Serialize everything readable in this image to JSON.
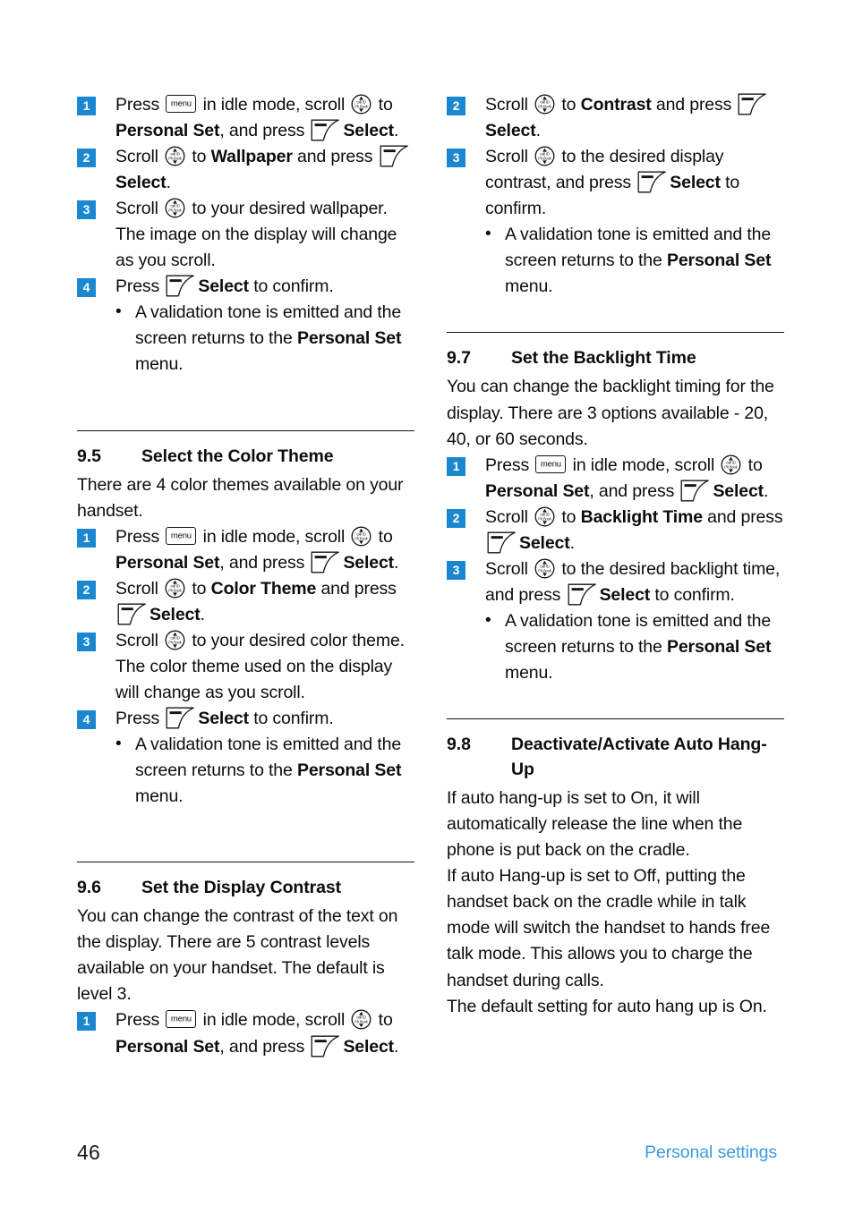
{
  "document": {
    "footer": {
      "page_number": "46",
      "section_title": "Personal settings"
    },
    "accent_color": "#1a87d0",
    "footer_link_color": "#3c9ae0"
  },
  "icons": {
    "menu_key_label": "menu",
    "scroll_key_top_label": "call ID",
    "scroll_key_bottom_label": "Ph.Book",
    "soft_key_name": "select-soft-key"
  },
  "left_column": {
    "wallpaper_steps": [
      {
        "number": "1",
        "parts": [
          {
            "t": "text",
            "v": "Press "
          },
          {
            "t": "icon",
            "v": "menu"
          },
          {
            "t": "text",
            "v": " in idle mode, scroll "
          },
          {
            "t": "icon",
            "v": "scroll"
          },
          {
            "t": "text",
            "v": " to "
          },
          {
            "t": "bold",
            "v": "Personal Set"
          },
          {
            "t": "text",
            "v": ", and press "
          },
          {
            "t": "icon",
            "v": "soft"
          },
          {
            "t": "bold",
            "v": "Select"
          },
          {
            "t": "text",
            "v": "."
          }
        ]
      },
      {
        "number": "2",
        "parts": [
          {
            "t": "text",
            "v": "Scroll "
          },
          {
            "t": "icon",
            "v": "scroll"
          },
          {
            "t": "text",
            "v": " to "
          },
          {
            "t": "bold",
            "v": "Wallpaper"
          },
          {
            "t": "text",
            "v": " and press "
          },
          {
            "t": "icon",
            "v": "soft"
          },
          {
            "t": "bold",
            "v": "Select"
          },
          {
            "t": "text",
            "v": "."
          }
        ]
      },
      {
        "number": "3",
        "parts": [
          {
            "t": "text",
            "v": "Scroll "
          },
          {
            "t": "icon",
            "v": "scroll"
          },
          {
            "t": "text",
            "v": " to your desired wallpaper. The image on the display will change as you scroll."
          }
        ]
      },
      {
        "number": "4",
        "parts": [
          {
            "t": "text",
            "v": "Press "
          },
          {
            "t": "icon",
            "v": "soft"
          },
          {
            "t": "bold",
            "v": "Select"
          },
          {
            "t": "text",
            "v": " to confirm."
          }
        ],
        "sub_bullets": [
          {
            "bullet": "•",
            "parts": [
              {
                "t": "text",
                "v": "A validation tone is emitted and the screen returns to the "
              },
              {
                "t": "bold",
                "v": "Personal Set"
              },
              {
                "t": "text",
                "v": " menu."
              }
            ]
          }
        ]
      }
    ],
    "section_9_5": {
      "number": "9.5",
      "title": "Select the Color Theme",
      "intro": "There are 4 color themes available on your handset.",
      "steps": [
        {
          "number": "1",
          "parts": [
            {
              "t": "text",
              "v": "Press "
            },
            {
              "t": "icon",
              "v": "menu"
            },
            {
              "t": "text",
              "v": " in idle mode, scroll "
            },
            {
              "t": "icon",
              "v": "scroll"
            },
            {
              "t": "text",
              "v": " to "
            },
            {
              "t": "bold",
              "v": "Personal Set"
            },
            {
              "t": "text",
              "v": ", and press "
            },
            {
              "t": "icon",
              "v": "soft"
            },
            {
              "t": "bold",
              "v": "Select"
            },
            {
              "t": "text",
              "v": "."
            }
          ]
        },
        {
          "number": "2",
          "parts": [
            {
              "t": "text",
              "v": "Scroll "
            },
            {
              "t": "icon",
              "v": "scroll"
            },
            {
              "t": "text",
              "v": " to "
            },
            {
              "t": "bold",
              "v": "Color Theme"
            },
            {
              "t": "text",
              "v": " and press "
            },
            {
              "t": "icon",
              "v": "soft"
            },
            {
              "t": "bold",
              "v": "Select"
            },
            {
              "t": "text",
              "v": "."
            }
          ]
        },
        {
          "number": "3",
          "parts": [
            {
              "t": "text",
              "v": "Scroll "
            },
            {
              "t": "icon",
              "v": "scroll"
            },
            {
              "t": "text",
              "v": " to your desired color theme. The color theme used on the display will change as you scroll."
            }
          ]
        },
        {
          "number": "4",
          "parts": [
            {
              "t": "text",
              "v": "Press "
            },
            {
              "t": "icon",
              "v": "soft"
            },
            {
              "t": "bold",
              "v": "Select"
            },
            {
              "t": "text",
              "v": " to confirm."
            }
          ],
          "sub_bullets": [
            {
              "bullet": "•",
              "parts": [
                {
                  "t": "text",
                  "v": "A validation tone is emitted and the screen returns to the "
                },
                {
                  "t": "bold",
                  "v": "Personal Set"
                },
                {
                  "t": "text",
                  "v": " menu."
                }
              ]
            }
          ]
        }
      ]
    },
    "section_9_6": {
      "number": "9.6",
      "title": "Set the Display Contrast",
      "intro": "You can change the contrast of the text on the display. There are 5 contrast levels available on your handset. The default is level 3.",
      "steps": [
        {
          "number": "1",
          "parts": [
            {
              "t": "text",
              "v": "Press "
            },
            {
              "t": "icon",
              "v": "menu"
            },
            {
              "t": "text",
              "v": " in idle mode, scroll "
            },
            {
              "t": "icon",
              "v": "scroll"
            },
            {
              "t": "text",
              "v": " to "
            },
            {
              "t": "bold",
              "v": "Personal Set"
            },
            {
              "t": "text",
              "v": ", and press "
            },
            {
              "t": "icon",
              "v": "soft"
            },
            {
              "t": "bold",
              "v": "Select"
            },
            {
              "t": "text",
              "v": "."
            }
          ]
        }
      ]
    }
  },
  "right_column": {
    "contrast_steps_continued": [
      {
        "number": "2",
        "parts": [
          {
            "t": "text",
            "v": "Scroll "
          },
          {
            "t": "icon",
            "v": "scroll"
          },
          {
            "t": "text",
            "v": " to "
          },
          {
            "t": "bold",
            "v": "Contrast"
          },
          {
            "t": "text",
            "v": " and press "
          },
          {
            "t": "icon",
            "v": "soft"
          },
          {
            "t": "bold",
            "v": "Select"
          },
          {
            "t": "text",
            "v": "."
          }
        ]
      },
      {
        "number": "3",
        "parts": [
          {
            "t": "text",
            "v": "Scroll "
          },
          {
            "t": "icon",
            "v": "scroll"
          },
          {
            "t": "text",
            "v": " to the desired display contrast, and press "
          },
          {
            "t": "icon",
            "v": "soft"
          },
          {
            "t": "bold",
            "v": "Select"
          },
          {
            "t": "text",
            "v": " to confirm."
          }
        ],
        "sub_bullets": [
          {
            "bullet": "•",
            "parts": [
              {
                "t": "text",
                "v": "A validation tone is emitted and the screen returns to the "
              },
              {
                "t": "bold",
                "v": "Personal Set"
              },
              {
                "t": "text",
                "v": " menu."
              }
            ]
          }
        ]
      }
    ],
    "section_9_7": {
      "number": "9.7",
      "title": "Set the Backlight Time",
      "intro": "You can change the backlight timing for the display. There are 3 options available - 20, 40, or 60 seconds.",
      "steps": [
        {
          "number": "1",
          "parts": [
            {
              "t": "text",
              "v": "Press "
            },
            {
              "t": "icon",
              "v": "menu"
            },
            {
              "t": "text",
              "v": " in idle mode, scroll "
            },
            {
              "t": "icon",
              "v": "scroll"
            },
            {
              "t": "text",
              "v": " to "
            },
            {
              "t": "bold",
              "v": "Personal Set"
            },
            {
              "t": "text",
              "v": ", and press "
            },
            {
              "t": "icon",
              "v": "soft"
            },
            {
              "t": "bold",
              "v": "Select"
            },
            {
              "t": "text",
              "v": "."
            }
          ]
        },
        {
          "number": "2",
          "parts": [
            {
              "t": "text",
              "v": "Scroll "
            },
            {
              "t": "icon",
              "v": "scroll"
            },
            {
              "t": "text",
              "v": " to "
            },
            {
              "t": "bold",
              "v": "Backlight Time"
            },
            {
              "t": "text",
              "v": " and press "
            },
            {
              "t": "icon",
              "v": "soft"
            },
            {
              "t": "bold",
              "v": "Select"
            },
            {
              "t": "text",
              "v": "."
            }
          ]
        },
        {
          "number": "3",
          "parts": [
            {
              "t": "text",
              "v": "Scroll "
            },
            {
              "t": "icon",
              "v": "scroll"
            },
            {
              "t": "text",
              "v": " to the desired backlight time, and press "
            },
            {
              "t": "icon",
              "v": "soft"
            },
            {
              "t": "bold",
              "v": "Select"
            },
            {
              "t": "text",
              "v": " to confirm."
            }
          ],
          "sub_bullets": [
            {
              "bullet": "•",
              "parts": [
                {
                  "t": "text",
                  "v": "A validation tone is emitted and the screen returns to the "
                },
                {
                  "t": "bold",
                  "v": "Personal Set"
                },
                {
                  "t": "text",
                  "v": " menu."
                }
              ]
            }
          ]
        }
      ]
    },
    "section_9_8": {
      "number": "9.8",
      "title": "Deactivate/Activate Auto Hang-Up",
      "paragraphs": [
        "If auto hang-up is set to On, it will automatically release the line when the phone is put back on the cradle.",
        "If auto Hang-up is set to Off, putting the handset back on the cradle while in talk mode will switch the handset to hands free talk mode. This allows you to charge the handset during calls.",
        "The default setting for auto hang up is On."
      ]
    }
  }
}
